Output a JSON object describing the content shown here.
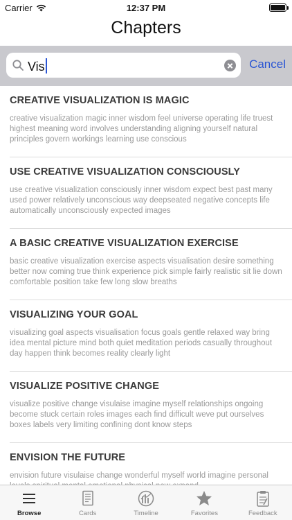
{
  "status": {
    "carrier": "Carrier",
    "time": "12:37 PM"
  },
  "nav": {
    "title": "Chapters"
  },
  "search": {
    "value": "Vis",
    "cancel_label": "Cancel"
  },
  "chapters": [
    {
      "title": "CREATIVE VISUALIZATION IS MAGIC",
      "snippet": "creative visualization magic inner wisdom feel universe operating life truest highest meaning word involves understanding aligning yourself natural principles govern workings learning use conscious"
    },
    {
      "title": "USE CREATIVE VISUALIZATION CONSCIOUSLY",
      "snippet": "use creative visualization consciously inner wisdom expect best past many used power relatively unconscious way deepseated negative concepts life automatically unconsciously expected images"
    },
    {
      "title": "A BASIC CREATIVE VISUALIZATION EXERCISE",
      "snippet": "basic creative visualization exercise aspects visualisation desire something better now coming true think experience pick simple fairly realistic sit lie down comfortable position take few long slow breaths"
    },
    {
      "title": "VISUALIZING YOUR GOAL",
      "snippet": "visualizing goal aspects visualisation focus goals gentle relaxed way bring idea mental picture mind both quiet meditation periods casually throughout day happen think becomes reality clearly light"
    },
    {
      "title": "VISUALIZE POSITIVE CHANGE",
      "snippet": "visualize positive change visulaise imagine myself relationships ongoing become stuck certain roles images each find difficult weve put ourselves boxes labels very limiting confining dont know steps"
    },
    {
      "title": "ENVISION THE FUTURE",
      "snippet": "envision future visulaise change wonderful myself world imagine personal levels spiritual mental emotional physical new expand"
    }
  ],
  "tabs": [
    {
      "label": "Browse",
      "icon": "list-icon",
      "active": true
    },
    {
      "label": "Cards",
      "icon": "cards-icon",
      "active": false
    },
    {
      "label": "Timeline",
      "icon": "timeline-icon",
      "active": false
    },
    {
      "label": "Favorites",
      "icon": "star-icon",
      "active": false
    },
    {
      "label": "Feedback",
      "icon": "clipboard-icon",
      "active": false
    }
  ]
}
